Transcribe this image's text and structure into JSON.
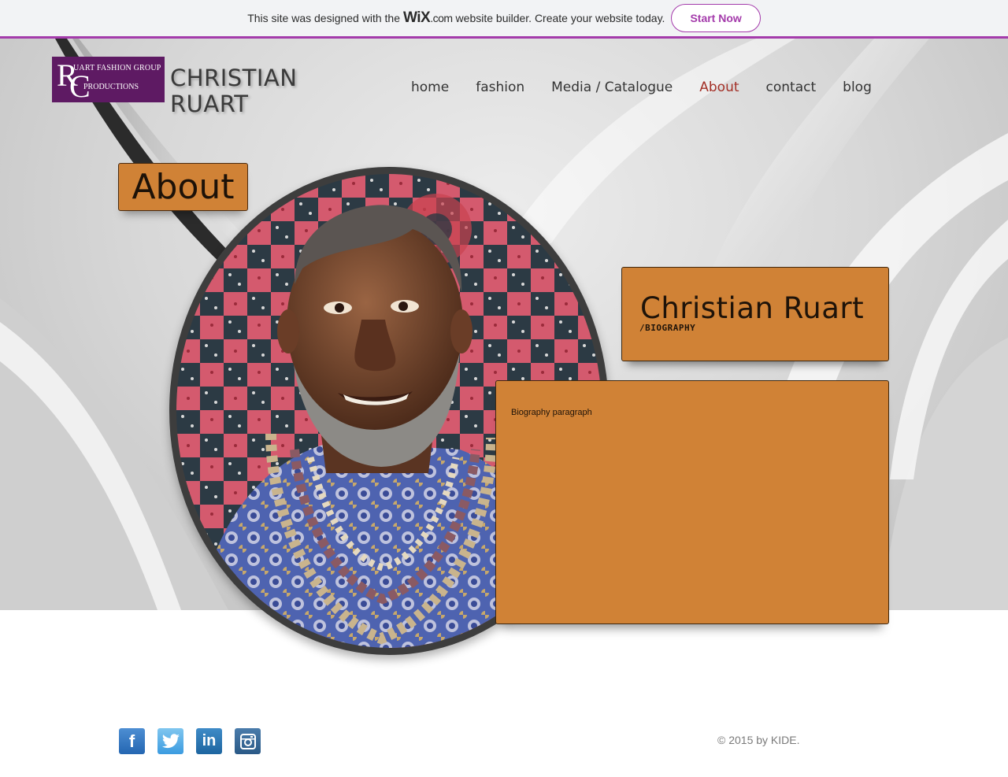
{
  "wix_banner": {
    "text_before": "This site was designed with the",
    "wix_logo": "WiX",
    "wix_domain": ".com",
    "text_after": "website builder. Create your website today.",
    "cta_label": "Start Now",
    "accent": "#a43bab"
  },
  "header": {
    "logo": {
      "monogram_r": "R",
      "monogram_c": "C",
      "line1": "UART FASHION GROUP",
      "line2": "PRODUCTIONS",
      "background": "#5e1a63"
    },
    "site_title_line1": "CHRISTIAN",
    "site_title_line2": "RUART"
  },
  "nav": {
    "items": [
      {
        "label": "home",
        "active": false
      },
      {
        "label": "fashion",
        "active": false
      },
      {
        "label": "Media / Catalogue",
        "active": false
      },
      {
        "label": "About",
        "active": true
      },
      {
        "label": "contact",
        "active": false
      },
      {
        "label": "blog",
        "active": false
      }
    ],
    "active_color": "#a33027"
  },
  "page": {
    "heading": "About",
    "accent": "#d08236"
  },
  "bio_card": {
    "name": "Christian Ruart",
    "subtitle": "/BIOGRAPHY",
    "paragraph": "Biography paragraph"
  },
  "footer": {
    "social_icons": [
      "facebook-icon",
      "twitter-icon",
      "linkedin-icon",
      "instagram-icon"
    ],
    "copyright": "© 2015 by KIDE."
  }
}
